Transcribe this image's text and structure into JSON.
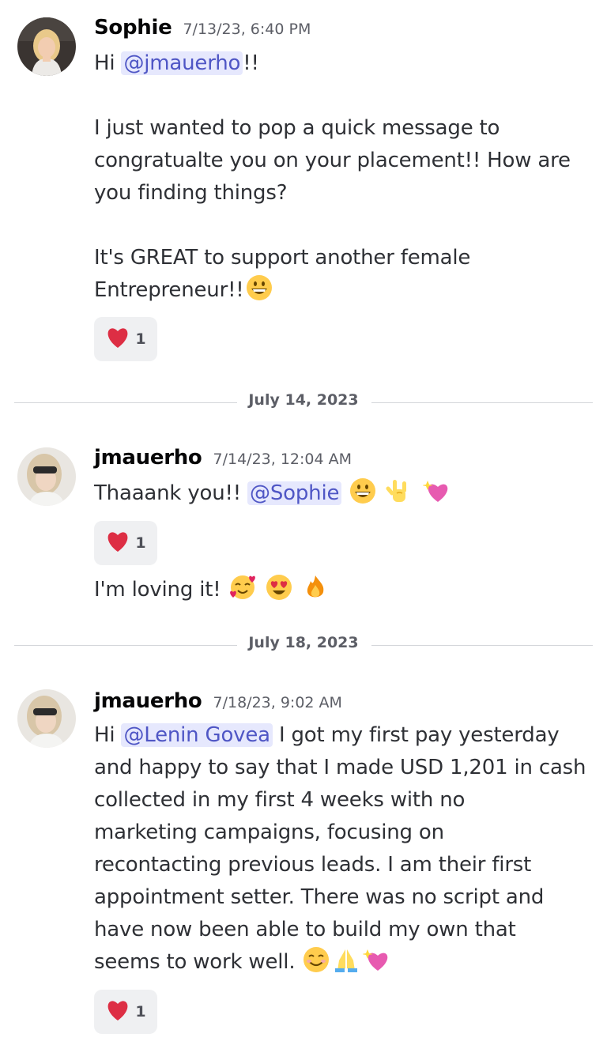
{
  "messages": [
    {
      "username": "Sophie",
      "timestamp": "7/13/23, 6:40 PM",
      "lines": {
        "l1_prefix": "Hi ",
        "l1_mention": "@jmauerho",
        "l1_suffix": "!!",
        "l2": "I just wanted to pop a quick message to",
        "l3": "congratualte you on your placement!! How are",
        "l4": "you finding things?",
        "l5": "It's GREAT to support another female",
        "l6": "Entrepreneur!!"
      },
      "reaction": {
        "emoji": "red-heart",
        "count": "1"
      }
    },
    {
      "username": "jmauerho",
      "timestamp": "7/14/23, 12:04 AM",
      "lines": {
        "l1_prefix": "Thaaank you!! ",
        "l1_mention": "@Sophie"
      },
      "reaction": {
        "emoji": "red-heart",
        "count": "1"
      },
      "followup": "I'm loving it!"
    },
    {
      "username": "jmauerho",
      "timestamp": "7/18/23, 9:02 AM",
      "lines": {
        "l1_prefix": "Hi ",
        "l1_mention": "@Lenin Govea",
        "l1_suffix": " I got my first pay yesterday",
        "l2": "and happy to say that I made USD 1,201 in cash",
        "l3": "collected in my first 4 weeks with no",
        "l4": "marketing campaigns, focusing on",
        "l5": "recontacting previous leads. I am their first",
        "l6": "appointment setter. There was no script and",
        "l7": "have now been able to build my own that",
        "l8": "seems to work well."
      },
      "reaction": {
        "emoji": "red-heart",
        "count": "1"
      }
    }
  ],
  "dividers": [
    "July 14, 2023",
    "July 18, 2023"
  ],
  "colors": {
    "mention_bg": "#e6e8fd",
    "mention_text": "#4f56c5",
    "reaction_bg": "#eff0f2",
    "divider_line": "#d4d6da"
  }
}
